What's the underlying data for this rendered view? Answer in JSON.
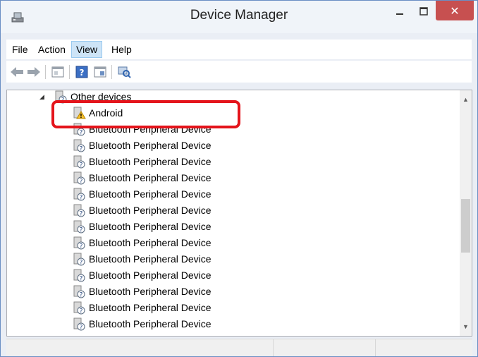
{
  "window": {
    "title": "Device Manager",
    "controls": {
      "minimize": "minimize-icon",
      "maximize": "maximize-icon",
      "close": "close-icon"
    },
    "close_color": "#c75050"
  },
  "menu": {
    "file": "File",
    "action": "Action",
    "view": "View",
    "help": "Help"
  },
  "toolbar": {
    "icons": [
      "back-arrow-icon",
      "forward-arrow-icon",
      "properties-icon",
      "help-icon",
      "toggle-view-icon",
      "scan-hardware-icon"
    ]
  },
  "tree": {
    "category": "Other devices",
    "devices": [
      "Android",
      "Bluetooth Peripheral Device",
      "Bluetooth Peripheral Device",
      "Bluetooth Peripheral Device",
      "Bluetooth Peripheral Device",
      "Bluetooth Peripheral Device",
      "Bluetooth Peripheral Device",
      "Bluetooth Peripheral Device",
      "Bluetooth Peripheral Device",
      "Bluetooth Peripheral Device",
      "Bluetooth Peripheral Device",
      "Bluetooth Peripheral Device",
      "Bluetooth Peripheral Device",
      "Bluetooth Peripheral Device"
    ],
    "highlighted_device": "Android",
    "highlight_color": "#e4141b"
  },
  "status": {
    "text": ""
  }
}
